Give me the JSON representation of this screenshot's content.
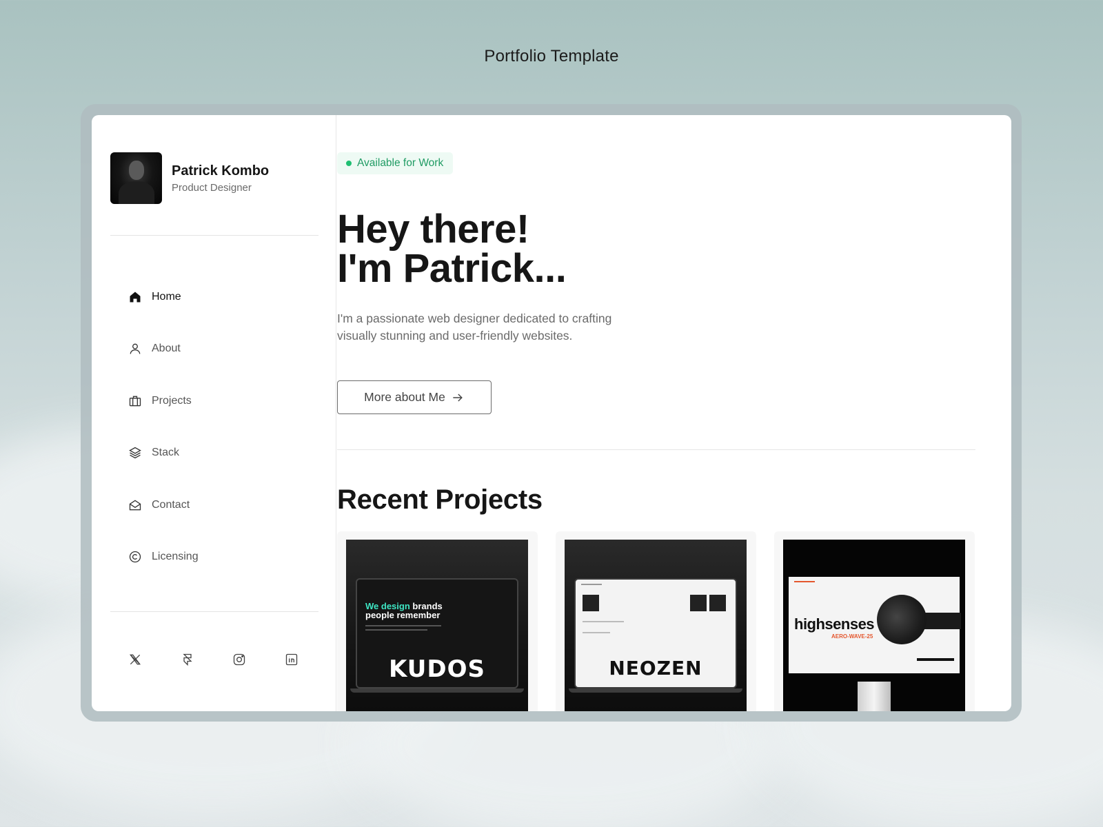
{
  "page": {
    "title": "Portfolio Template"
  },
  "profile": {
    "name": "Patrick Kombo",
    "role": "Product Designer"
  },
  "nav": {
    "items": [
      {
        "label": "Home",
        "icon": "home-icon",
        "active": true
      },
      {
        "label": "About",
        "icon": "user-icon",
        "active": false
      },
      {
        "label": "Projects",
        "icon": "briefcase-icon",
        "active": false
      },
      {
        "label": "Stack",
        "icon": "layers-icon",
        "active": false
      },
      {
        "label": "Contact",
        "icon": "mail-icon",
        "active": false
      },
      {
        "label": "Licensing",
        "icon": "copyright-icon",
        "active": false
      }
    ]
  },
  "socials": [
    "x-icon",
    "framer-icon",
    "instagram-icon",
    "linkedin-icon"
  ],
  "hero": {
    "badge": "Available for Work",
    "title": "Hey there!\nI'm Patrick...",
    "text": "I'm  a passionate web designer dedicated to crafting visually stunning and user-friendly websites.",
    "cta": "More about Me"
  },
  "projects": {
    "title": "Recent Projects",
    "items": [
      {
        "name": "KUDOS",
        "tagline_accent": "We design",
        "tagline_rest": "brands",
        "tagline_line2": "people remember"
      },
      {
        "name": "NEOZEN"
      },
      {
        "name": "highsenses",
        "sub": "AERO-WAVE-25"
      }
    ]
  },
  "colors": {
    "accent_green": "#1fbf72",
    "badge_bg": "#eefaf4",
    "kudos_accent": "#3ee6c4",
    "highsenses_accent": "#e4572e"
  }
}
